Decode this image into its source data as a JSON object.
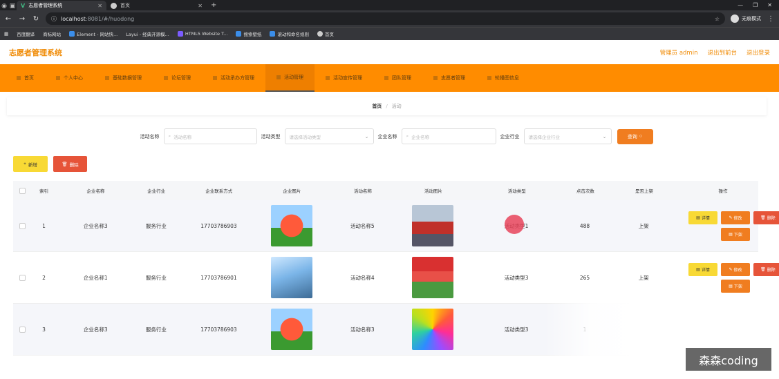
{
  "browser": {
    "tabs": [
      {
        "title": "志愿者管理系统",
        "active": true
      },
      {
        "title": "首页",
        "active": false
      }
    ],
    "url_host": "localhost",
    "url_path": ":8081/#/huodong",
    "profile_label": "无痕模式",
    "bookmarks": [
      "百度翻译",
      "商标网站",
      "Element - 网站快...",
      "Layui - 经典开源模...",
      "HTML5 Website T...",
      "搜索壁纸",
      "滚动和命名规则",
      "首页"
    ]
  },
  "app": {
    "title": "志愿者管理系统",
    "user_label": "管理员 admin",
    "back_link": "退出到前台",
    "logout_link": "退出登录"
  },
  "menu": [
    "首页",
    "个人中心",
    "基础数据管理",
    "论坛管理",
    "活动承办方管理",
    "活动管理",
    "活动宣传管理",
    "团队管理",
    "志愿者管理",
    "轮播图信息"
  ],
  "menu_active_index": 5,
  "breadcrumb": {
    "home": "首页",
    "sep": "/",
    "current": "活动"
  },
  "search": {
    "name_label": "活动名称",
    "name_placeholder": "活动名称",
    "type_label": "活动类型",
    "type_placeholder": "请选择活动类型",
    "company_label": "企业名称",
    "company_placeholder": "企业名称",
    "industry_label": "企业行业",
    "industry_placeholder": "请选择企业行业",
    "query_label": "查询"
  },
  "actions": {
    "add_label": "新增",
    "delete_label": "删除"
  },
  "table": {
    "headers": [
      "索引",
      "企业名称",
      "企业行业",
      "企业联系方式",
      "企业图片",
      "活动名称",
      "活动图片",
      "活动类型",
      "点击次数",
      "是否上架",
      "操作"
    ],
    "rows": [
      {
        "index": "1",
        "company": "企业名称3",
        "industry": "服务行业",
        "phone": "17703786903",
        "company_img": "fox",
        "name": "活动名称5",
        "activity_img": "crowd",
        "type": "活动类型1",
        "clicks": "488",
        "status": "上架"
      },
      {
        "index": "2",
        "company": "企业名称1",
        "industry": "服务行业",
        "phone": "17703786901",
        "company_img": "boy",
        "name": "活动名称4",
        "activity_img": "stage",
        "type": "活动类型3",
        "clicks": "265",
        "status": "上架"
      },
      {
        "index": "3",
        "company": "企业名称3",
        "industry": "服务行业",
        "phone": "17703786903",
        "company_img": "fox",
        "name": "活动名称3",
        "activity_img": "rainbow",
        "type": "活动类型3",
        "clicks": "1",
        "status": ""
      }
    ],
    "ops": {
      "detail": "详情",
      "edit": "修改",
      "remove": "删除",
      "down": "下架"
    }
  },
  "watermark": "森森coding",
  "colors": {
    "accent": "#ff8c00",
    "title": "#f08d0a",
    "danger": "#e65439",
    "warn": "#f8d935"
  }
}
